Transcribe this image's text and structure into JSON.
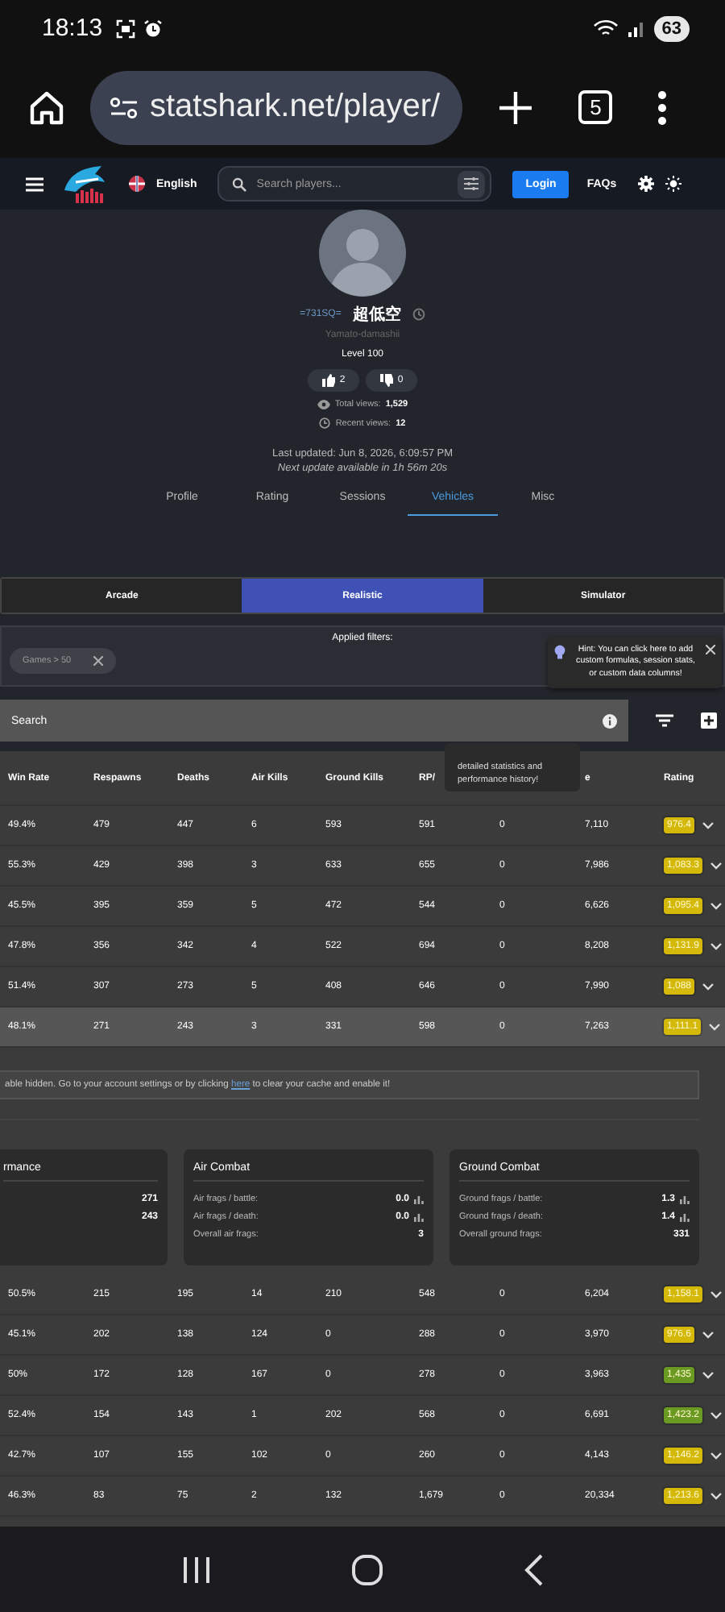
{
  "status_bar": {
    "time": "18:13",
    "battery": "63"
  },
  "browser": {
    "url": "statshark.net/player/",
    "tab_count": "5"
  },
  "site_header": {
    "language": "English",
    "search_placeholder": "Search players...",
    "login": "Login",
    "faqs": "FAQs"
  },
  "profile": {
    "squadron": "=731SQ=",
    "name": "超低空",
    "title": "Yamato-damashii",
    "level": "Level 100",
    "likes": "2",
    "dislikes": "0",
    "total_views_label": "Total views:",
    "total_views": "1,529",
    "recent_views_label": "Recent views:",
    "recent_views": "12",
    "last_updated": "Last updated: Jun 8, 2026, 6:09:57 PM",
    "next_update": "Next update available in 1h 56m 20s"
  },
  "tabs": [
    {
      "label": "Profile",
      "selected": false
    },
    {
      "label": "Rating",
      "selected": false
    },
    {
      "label": "Sessions",
      "selected": false
    },
    {
      "label": "Vehicles",
      "selected": true
    },
    {
      "label": "Misc",
      "selected": false
    }
  ],
  "modes": [
    {
      "label": "Arcade",
      "selected": false
    },
    {
      "label": "Realistic",
      "selected": true
    },
    {
      "label": "Simulator",
      "selected": false
    }
  ],
  "filters": {
    "title": "Applied filters:",
    "chips": [
      "Games > 50"
    ]
  },
  "hint": {
    "text": "Hint: You can click here to add custom formulas, session stats, or custom data columns!"
  },
  "search": {
    "placeholder": "Search"
  },
  "table": {
    "columns": [
      "Win Rate",
      "Respawns",
      "Deaths",
      "Air Kills",
      "Ground Kills",
      "RP/",
      "",
      "e",
      "Rating"
    ],
    "tooltip": "detailed statistics and performance history!",
    "rows": [
      {
        "cells": [
          "49.4%",
          "479",
          "447",
          "6",
          "593",
          "591",
          "0",
          "7,110"
        ],
        "rating": "976.4",
        "color": "#d4b90a",
        "selected": false
      },
      {
        "cells": [
          "55.3%",
          "429",
          "398",
          "3",
          "633",
          "655",
          "0",
          "7,986"
        ],
        "rating": "1,083.3",
        "color": "#d4b90a",
        "selected": false
      },
      {
        "cells": [
          "45.5%",
          "395",
          "359",
          "5",
          "472",
          "544",
          "0",
          "6,626"
        ],
        "rating": "1,095.4",
        "color": "#d4b90a",
        "selected": false
      },
      {
        "cells": [
          "47.8%",
          "356",
          "342",
          "4",
          "522",
          "694",
          "0",
          "8,208"
        ],
        "rating": "1,131.9",
        "color": "#d4b90a",
        "selected": false
      },
      {
        "cells": [
          "51.4%",
          "307",
          "273",
          "5",
          "408",
          "646",
          "0",
          "7,990"
        ],
        "rating": "1,088",
        "color": "#d4b90a",
        "selected": false
      },
      {
        "cells": [
          "48.1%",
          "271",
          "243",
          "3",
          "331",
          "598",
          "0",
          "7,263"
        ],
        "rating": "1,111.1",
        "color": "#d4b90a",
        "selected": true
      }
    ]
  },
  "notice": {
    "before": "able hidden. Go to your account settings or by clicking",
    "link": "here",
    "after": "to clear your cache and enable it!"
  },
  "cards": [
    {
      "title": "rmance",
      "rows": [
        {
          "label": "",
          "value": "271",
          "chart": false
        },
        {
          "label": "",
          "value": "243",
          "chart": false
        }
      ]
    },
    {
      "title": "Air Combat",
      "rows": [
        {
          "label": "Air frags / battle:",
          "value": "0.0",
          "chart": true
        },
        {
          "label": "Air frags / death:",
          "value": "0.0",
          "chart": true
        },
        {
          "label": "Overall air frags:",
          "value": "3",
          "chart": false
        }
      ]
    },
    {
      "title": "Ground Combat",
      "rows": [
        {
          "label": "Ground frags / battle:",
          "value": "1.3",
          "chart": true
        },
        {
          "label": "Ground frags / death:",
          "value": "1.4",
          "chart": true
        },
        {
          "label": "Overall ground frags:",
          "value": "331",
          "chart": false
        }
      ]
    }
  ],
  "more_rows": [
    {
      "cells": [
        "50.5%",
        "215",
        "195",
        "14",
        "210",
        "548",
        "0",
        "6,204"
      ],
      "rating": "1,158.1",
      "color": "#d4b90a",
      "selected": false
    },
    {
      "cells": [
        "45.1%",
        "202",
        "138",
        "124",
        "0",
        "288",
        "0",
        "3,970"
      ],
      "rating": "976.6",
      "color": "#d4b90a",
      "selected": false
    },
    {
      "cells": [
        "50%",
        "172",
        "128",
        "167",
        "0",
        "278",
        "0",
        "3,963"
      ],
      "rating": "1,435",
      "color": "#6b9a22",
      "selected": false
    },
    {
      "cells": [
        "52.4%",
        "154",
        "143",
        "1",
        "202",
        "568",
        "0",
        "6,691"
      ],
      "rating": "1,423.2",
      "color": "#6b9a22",
      "selected": false
    },
    {
      "cells": [
        "42.7%",
        "107",
        "155",
        "102",
        "0",
        "260",
        "0",
        "4,143"
      ],
      "rating": "1,146.2",
      "color": "#d4b90a",
      "selected": false
    },
    {
      "cells": [
        "46.3%",
        "83",
        "75",
        "2",
        "132",
        "1,679",
        "0",
        "20,334"
      ],
      "rating": "1,213.6",
      "color": "#d4b90a",
      "selected": false
    }
  ]
}
